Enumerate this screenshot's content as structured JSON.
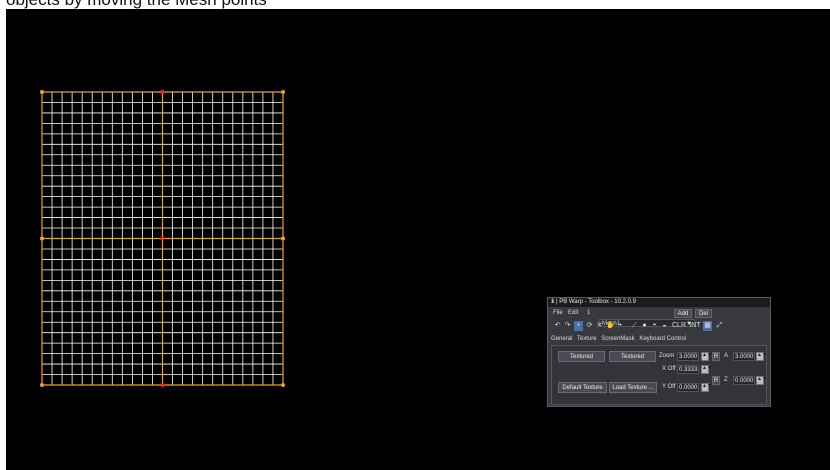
{
  "caption": "objects by moving the Mesh points",
  "toolbox": {
    "title": "1 | PB Warp - Toolbox - 10.2.0.9",
    "close": "×",
    "menu": {
      "file": "File",
      "edit": "Edit",
      "index": "1"
    },
    "mesh_select": {
      "value": "Mesh1",
      "arrow": "▼"
    },
    "add": "Add",
    "del": "Del",
    "icons": {
      "undo": "↶",
      "redo": "↷",
      "move": "+",
      "rotate": "⟳",
      "scale": "✕",
      "hand": "✋",
      "point": "•",
      "line": "⟋",
      "circle": "●",
      "ring": "◓",
      "arc": "◒",
      "clr": "CLR",
      "int": "INT",
      "grid": "▦",
      "expand": "⤢"
    },
    "tabs": [
      "General",
      "Texture",
      "ScreenMask",
      "Keyboard Control"
    ],
    "panel": {
      "textured_1": "Textured",
      "textured_2": "Textured",
      "default_texture": "Default Texture",
      "load_texture": "Load Texture ...",
      "zoom_label": "Zoom",
      "zoom_value": "3.0000",
      "xoff_label": "X Off",
      "xoff_value": "0.3333",
      "yoff_label": "Y Off",
      "yoff_value": "0.0000",
      "r_label": "R",
      "a_label": "A",
      "a_value": "3.0000",
      "z_label": "Z",
      "z_value": "0.0000",
      "spin_symbol": "▲▼"
    }
  },
  "mesh": {
    "grid_color": "#ffffff",
    "frame_color": "#f0a020",
    "control_point_color": "#ff2020",
    "corner_point_color": "#f0a020"
  }
}
